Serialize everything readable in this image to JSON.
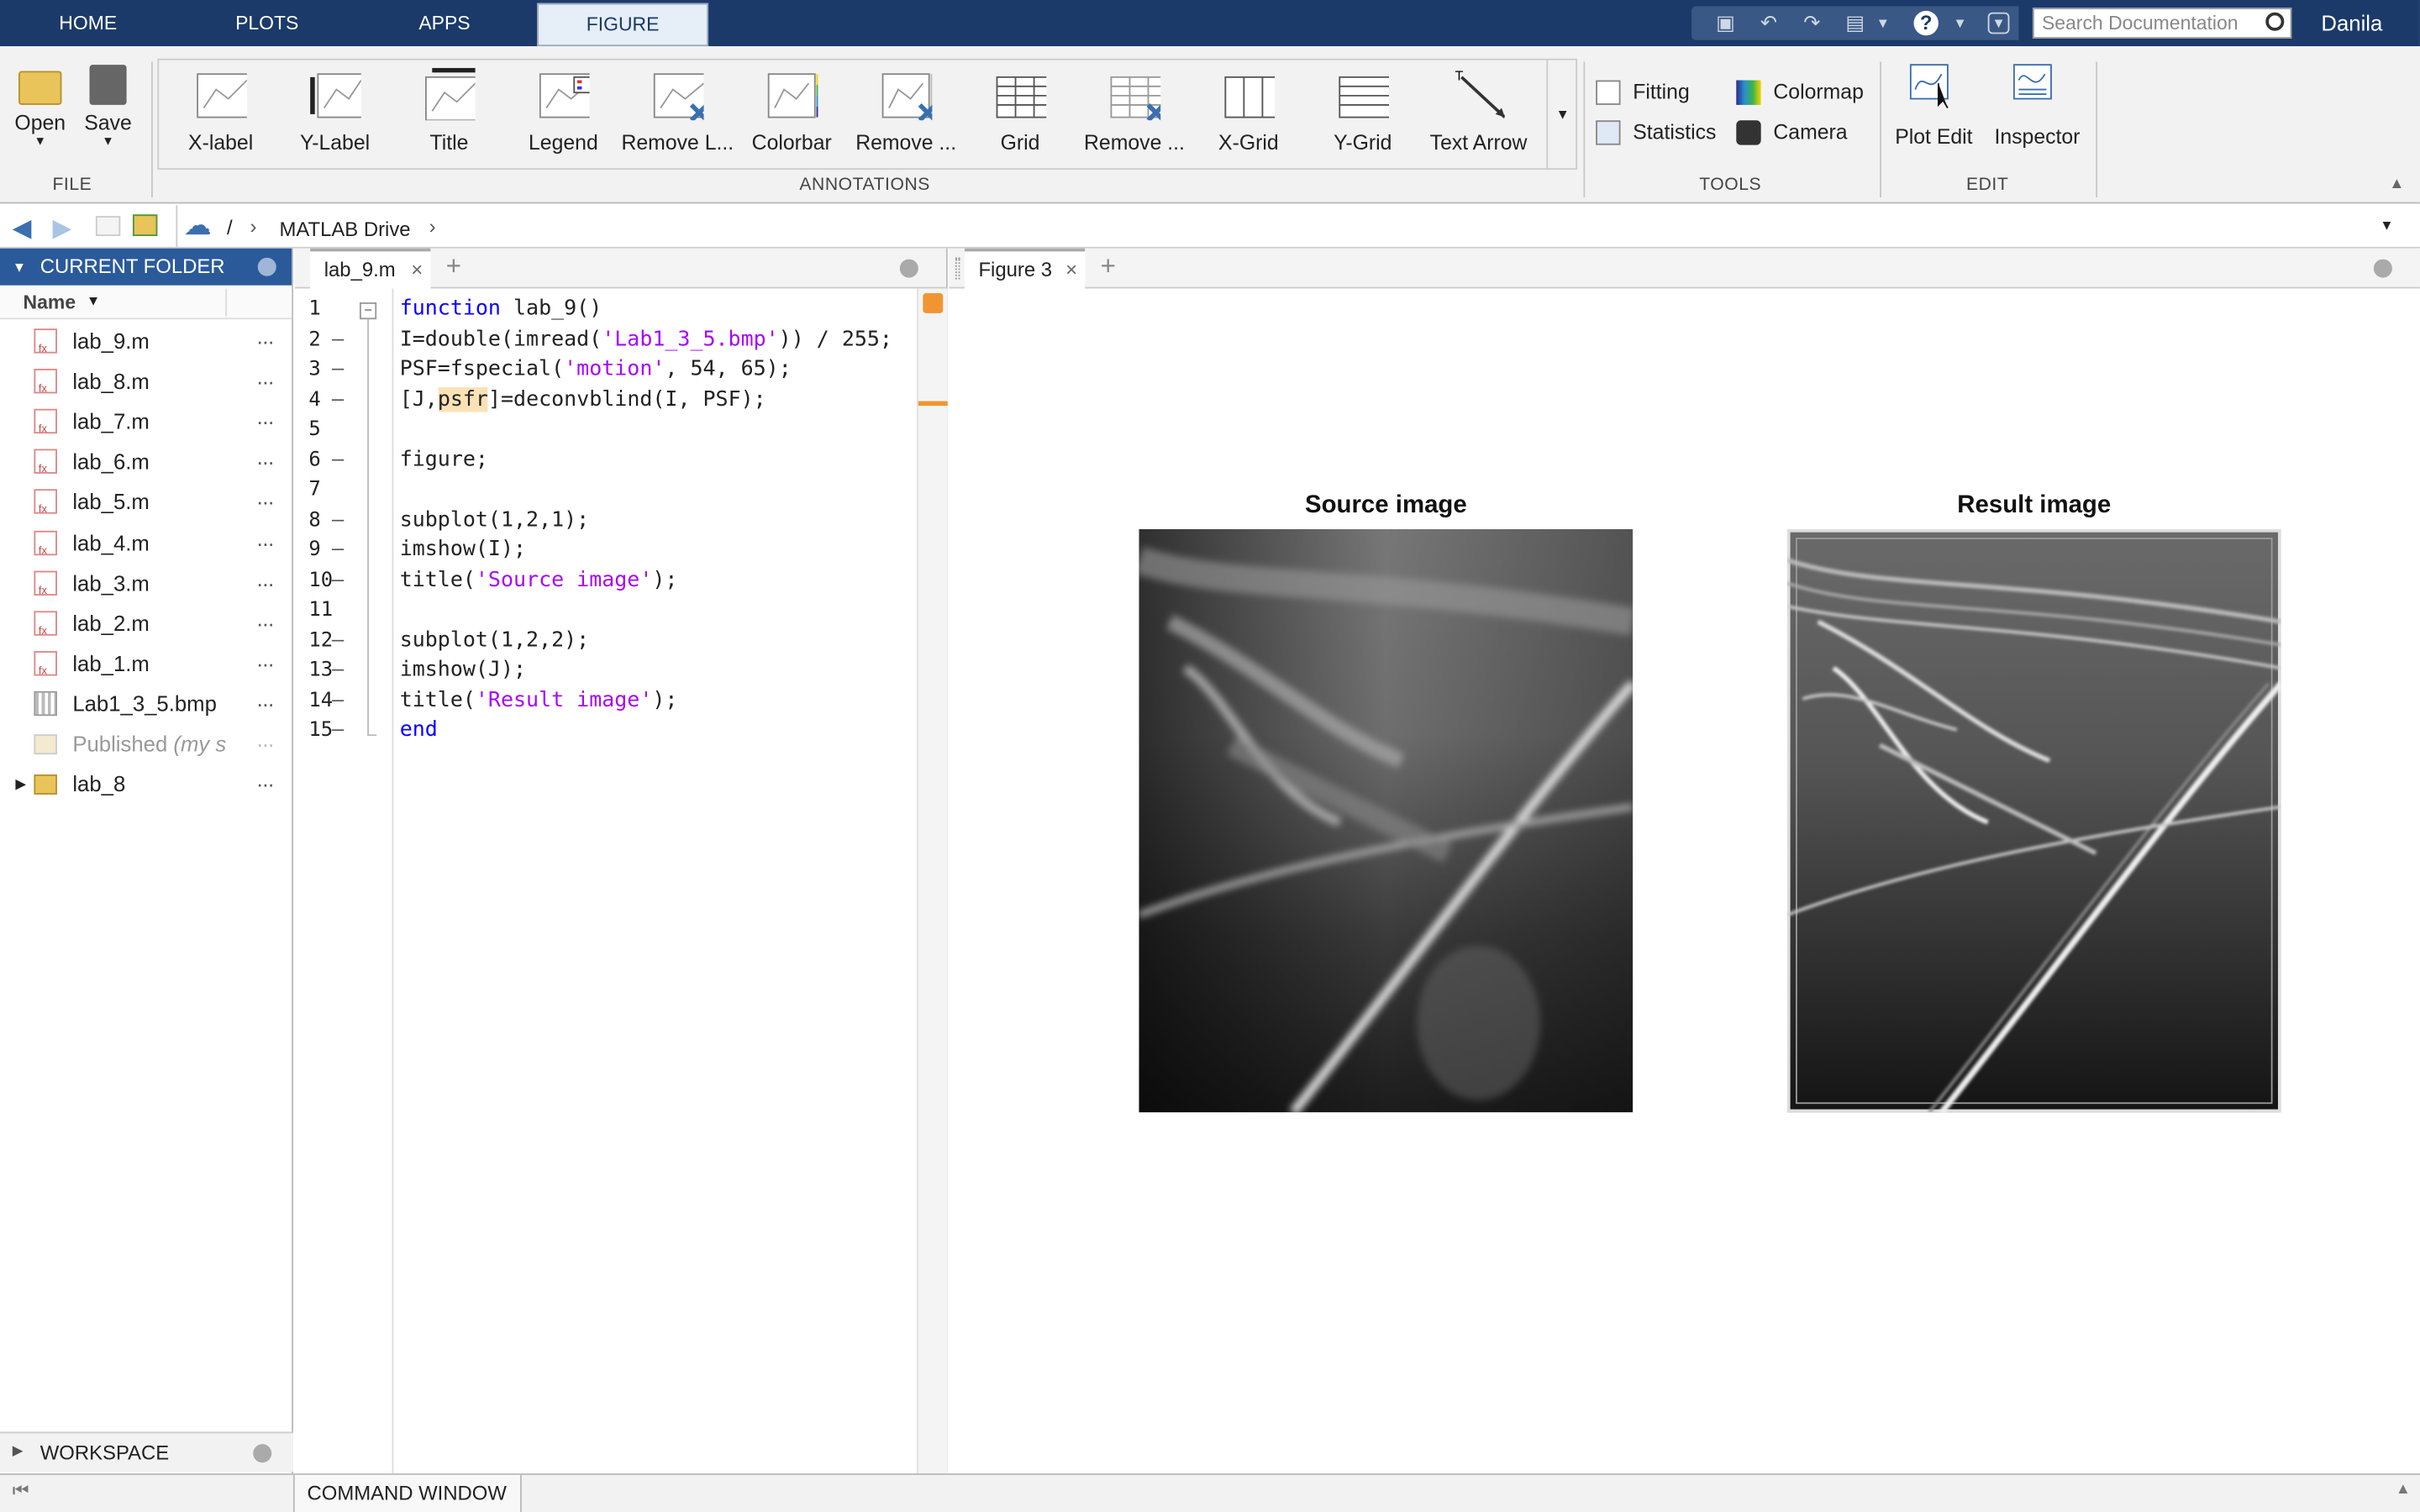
{
  "top_tabs": [
    "HOME",
    "PLOTS",
    "APPS",
    "FIGURE"
  ],
  "search": {
    "placeholder": "Search Documentation"
  },
  "user": "Danila",
  "ribbon": {
    "file": {
      "open": "Open",
      "save": "Save",
      "group": "FILE"
    },
    "annotations": {
      "items": [
        "X-label",
        "Y-Label",
        "Title",
        "Legend",
        "Remove L...",
        "Colorbar",
        "Remove ...",
        "Grid",
        "Remove ...",
        "X-Grid",
        "Y-Grid",
        "Text Arrow"
      ],
      "group": "ANNOTATIONS"
    },
    "tools": {
      "fitting": "Fitting",
      "statistics": "Statistics",
      "colormap": "Colormap",
      "camera": "Camera",
      "group": "TOOLS"
    },
    "edit": {
      "plot_edit": "Plot Edit",
      "inspector": "Inspector",
      "group": "EDIT"
    }
  },
  "address": {
    "root": "/",
    "folder": "MATLAB Drive"
  },
  "current_folder": {
    "title": "CURRENT FOLDER",
    "column": "Name",
    "files": [
      "lab_9.m",
      "lab_8.m",
      "lab_7.m",
      "lab_6.m",
      "lab_5.m",
      "lab_4.m",
      "lab_3.m",
      "lab_2.m",
      "lab_1.m",
      "Lab1_3_5.bmp"
    ],
    "published": "Published",
    "published_hint": "(my s",
    "folder": "lab_8"
  },
  "editor": {
    "tab": "lab_9.m",
    "lines": [
      "1",
      "2",
      "3",
      "4",
      "5",
      "6",
      "7",
      "8",
      "9",
      "10",
      "11",
      "12",
      "13",
      "14",
      "15"
    ],
    "code": {
      "l1_kw": "function",
      "l1_rest": " lab_9()",
      "l2_a": "I=double(imread(",
      "l2_s": "'Lab1_3_5.bmp'",
      "l2_b": ")) / 255;",
      "l3_a": "PSF=fspecial(",
      "l3_s": "'motion'",
      "l3_b": ", 54, 65);",
      "l4_a": "[J,",
      "l4_h": "psfr",
      "l4_b": "]=deconvblind(I, PSF);",
      "l6": "figure;",
      "l8": "subplot(1,2,1);",
      "l9": "imshow(I);",
      "l10_a": "title(",
      "l10_s": "'Source image'",
      "l10_b": ");",
      "l12": "subplot(1,2,2);",
      "l13": "imshow(J);",
      "l14_a": "title(",
      "l14_s": "'Result image'",
      "l14_b": ");",
      "l15": "end"
    }
  },
  "figure": {
    "tab": "Figure 3",
    "left_title": "Source image",
    "right_title": "Result image"
  },
  "workspace": "WORKSPACE",
  "command_window": "COMMAND WINDOW",
  "colors": {
    "top_bar": "#1b3a6a",
    "panel_header": "#2a5a9a",
    "keyword": "#0e00ff",
    "string": "#a709f5"
  }
}
